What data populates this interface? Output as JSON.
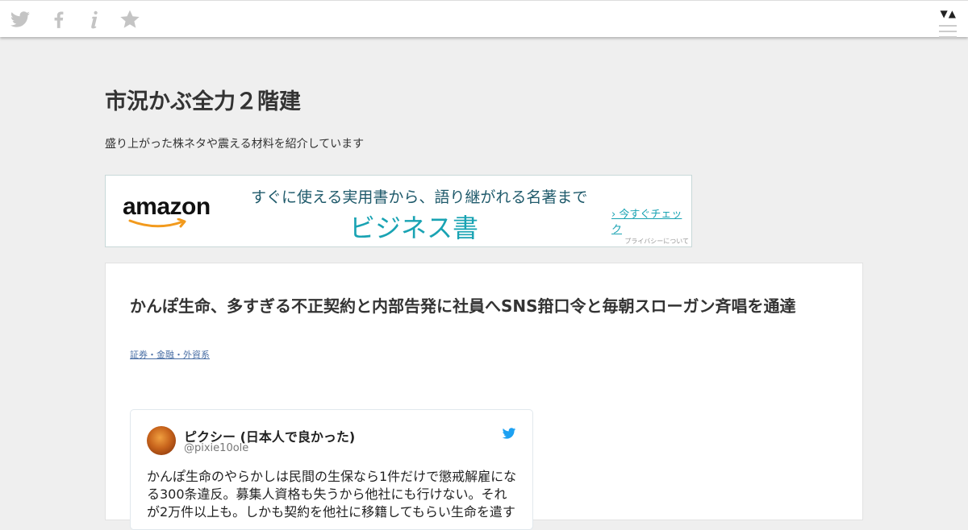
{
  "header": {
    "icons": [
      "twitter-icon",
      "facebook-icon",
      "info-icon",
      "star-icon",
      "menu-icon"
    ],
    "scroll_arrows": "▼▲"
  },
  "site": {
    "title": "市況かぶ全力２階建",
    "description": "盛り上がった株ネタや震える材料を紹介しています"
  },
  "ad": {
    "logo": "amazon",
    "tagline": "すぐに使える実用書から、語り継がれる名著まで",
    "headline": "ビジネス書",
    "cta": "› 今すぐチェック",
    "privacy": "プライバシーについて",
    "colors": {
      "accent": "#19a3b3",
      "smile": "#f29a1d"
    }
  },
  "post": {
    "title": "かんぽ生命、多すぎる不正契約と内部告発に社員へSNS箝口令と毎朝スローガン斉唱を通達",
    "category": "証券・金融・外資系"
  },
  "tweet": {
    "name": "ピクシー (日本人で良かった)",
    "handle": "@pixie10ole",
    "text": "かんぽ生命のやらかしは民間の生保なら1件だけで懲戒解雇になる300条違反。募集人資格も失うから他社にも行けない。それが2万件以上も。しかも契約を他社に移籍してもらい生命を遣す",
    "colors": {
      "bird": "#1da1f2"
    }
  }
}
